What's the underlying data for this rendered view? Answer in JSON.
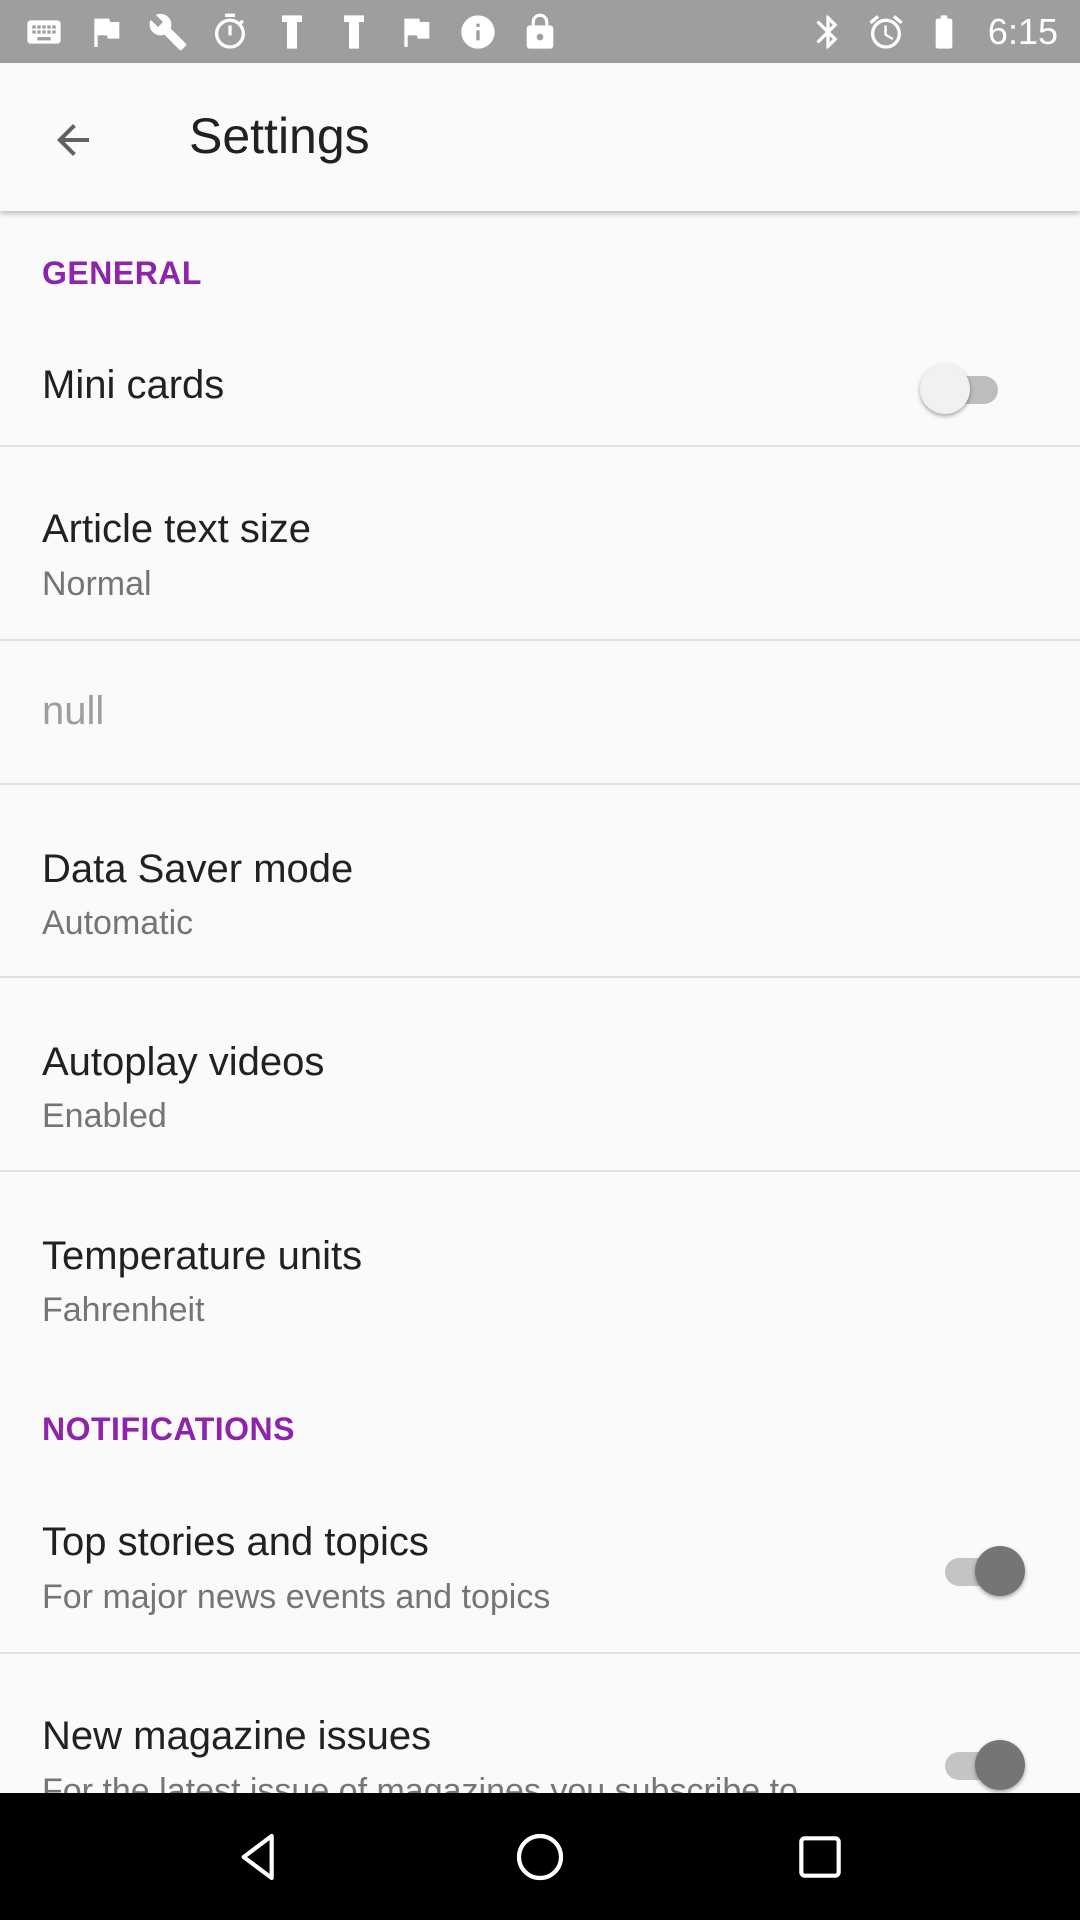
{
  "status_bar": {
    "time": "6:15",
    "left_icons": [
      "keyboard-icon",
      "flag-icon",
      "wrench-icon",
      "timer-icon",
      "tools-icon",
      "tools-icon-2",
      "flag-icon-2",
      "info-icon",
      "lock-icon"
    ],
    "right_icons": [
      "bluetooth-icon",
      "alarm-icon",
      "battery-icon"
    ]
  },
  "app_bar": {
    "back_icon": "arrow-back-icon",
    "title": "Settings"
  },
  "sections": {
    "general": {
      "header": "GENERAL",
      "mini_cards": {
        "title": "Mini cards",
        "toggle": "off"
      },
      "article_text_size": {
        "title": "Article text size",
        "value": "Normal"
      },
      "null_item": {
        "title": "null"
      },
      "data_saver": {
        "title": "Data Saver mode",
        "value": "Automatic"
      },
      "autoplay": {
        "title": "Autoplay videos",
        "value": "Enabled"
      },
      "temperature": {
        "title": "Temperature units",
        "value": "Fahrenheit"
      }
    },
    "notifications": {
      "header": "NOTIFICATIONS",
      "top_stories": {
        "title": "Top stories and topics",
        "subtitle": "For major news events and topics",
        "toggle": "on"
      },
      "magazine": {
        "title": "New magazine issues",
        "subtitle": "For the latest issue of magazines you subscribe to",
        "toggle": "on"
      }
    }
  },
  "nav_bar": {
    "back": "nav-back-icon",
    "home": "nav-home-icon",
    "recents": "nav-recents-icon"
  },
  "colors": {
    "accent": "#8e24aa",
    "status_bar": "#9e9e9e",
    "background": "#fafafa"
  }
}
